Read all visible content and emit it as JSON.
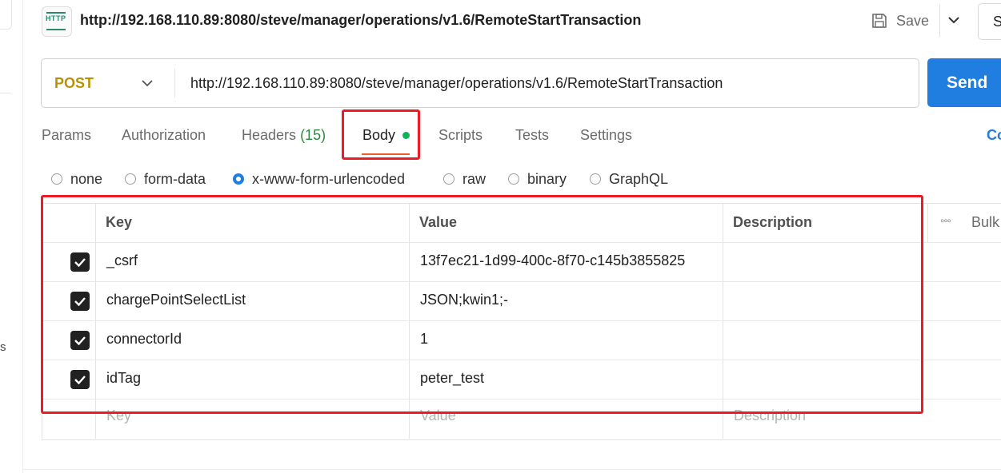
{
  "header": {
    "protocol_icon_label": "HTTP",
    "title": "http://192.168.110.89:8080/steve/manager/operations/v1.6/RemoteStartTransaction",
    "save_label": "Save",
    "share_fragment": "S"
  },
  "left_rail": {
    "fragment": "s"
  },
  "request": {
    "method": "POST",
    "url": "http://192.168.110.89:8080/steve/manager/operations/v1.6/RemoteStartTransaction",
    "send_label": "Send"
  },
  "tabs": {
    "params": "Params",
    "authorization": "Authorization",
    "headers": "Headers",
    "headers_count": "(15)",
    "body": "Body",
    "scripts": "Scripts",
    "tests": "Tests",
    "settings": "Settings",
    "cookies_fragment": "Co",
    "active": "Body"
  },
  "body_types": {
    "options": [
      "none",
      "form-data",
      "x-www-form-urlencoded",
      "raw",
      "binary",
      "GraphQL"
    ],
    "selected": "x-www-form-urlencoded"
  },
  "table": {
    "columns": {
      "key": "Key",
      "value": "Value",
      "description": "Description"
    },
    "bulk_edit_fragment": "Bulk",
    "rows": [
      {
        "checked": true,
        "key": "_csrf",
        "value": "13f7ec21-1d99-400c-8f70-c145b3855825",
        "description": ""
      },
      {
        "checked": true,
        "key": "chargePointSelectList",
        "value": "JSON;kwin1;-",
        "description": ""
      },
      {
        "checked": true,
        "key": "connectorId",
        "value": "1",
        "description": ""
      },
      {
        "checked": true,
        "key": "idTag",
        "value": "peter_test",
        "description": ""
      }
    ],
    "placeholders": {
      "key": "Key",
      "value": "Value",
      "description": "Description"
    }
  },
  "colors": {
    "method": "#b7910b",
    "send": "#1f7ee0",
    "active_tab_underline": "#ef5b25",
    "body_dot": "#10b25c",
    "headers_count": "#2b8a3e",
    "annotation": "#ed1c24"
  },
  "icons": [
    "http-icon",
    "save-icon",
    "chevron-down-icon",
    "more-icon",
    "check-icon"
  ]
}
